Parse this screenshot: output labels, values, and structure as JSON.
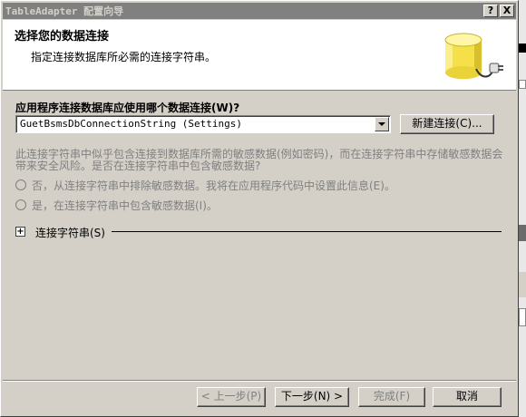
{
  "window": {
    "title": "TableAdapter 配置向导",
    "help_label": "?",
    "close_label": "X"
  },
  "header": {
    "title": "选择您的数据连接",
    "subtitle": "指定连接数据库所必需的连接字符串。",
    "icon": "database-plug-icon"
  },
  "connection": {
    "question": "应用程序连接数据库应使用哪个数据连接(W)?",
    "selected": "GuetBsmsDbConnectionString (Settings)",
    "new_button": "新建连接(C)..."
  },
  "sensitive": {
    "description": "此连接字符串中似乎包含连接到数据库所需的敏感数据(例如密码)，而在连接字符串中存储敏感数据会带来安全风险。是否在连接字符串中包含敏感数据?",
    "options": [
      {
        "label": "否，从连接字符串中排除敏感数据。我将在应用程序代码中设置此信息(E)。"
      },
      {
        "label": "是，在连接字符串中包含敏感数据(I)。"
      }
    ]
  },
  "expander": {
    "symbol": "+",
    "label": "连接字符串(S)"
  },
  "footer": {
    "back": "< 上一步(P)",
    "next": "下一步(N) >",
    "finish": "完成(F)",
    "cancel": "取消"
  },
  "colors": {
    "dialog_bg": "#d4d0c8",
    "titlebar_inactive": "#808080",
    "disabled_text": "#808080",
    "icon_yellow": "#f5e04a"
  }
}
